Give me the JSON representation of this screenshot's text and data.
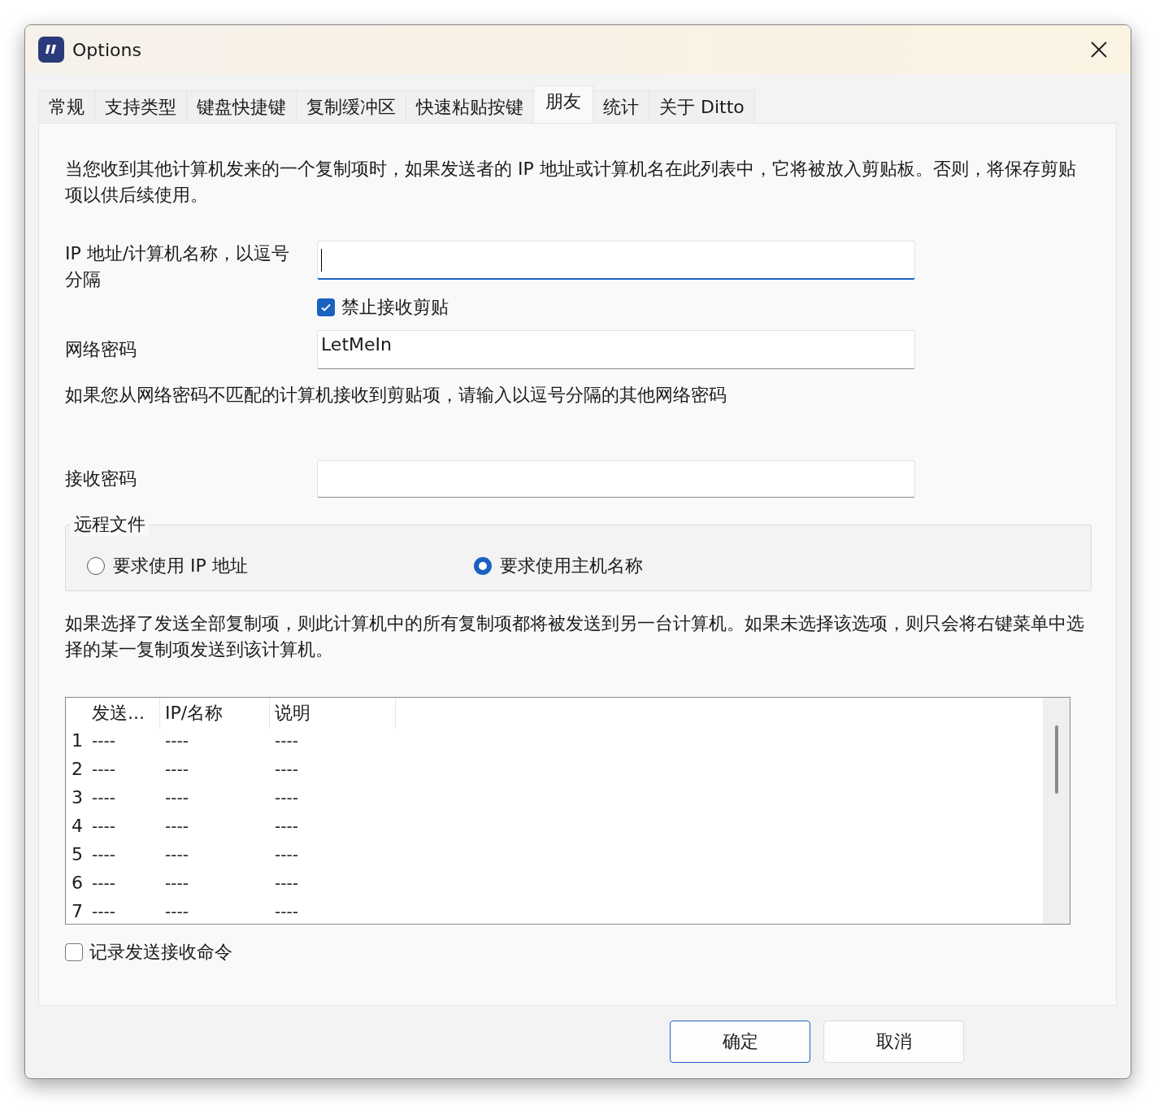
{
  "window": {
    "title": "Options"
  },
  "tabs": [
    {
      "label": "常规",
      "selected": false
    },
    {
      "label": "支持类型",
      "selected": false
    },
    {
      "label": "键盘快捷键",
      "selected": false
    },
    {
      "label": "复制缓冲区",
      "selected": false
    },
    {
      "label": "快速粘贴按键",
      "selected": false
    },
    {
      "label": "朋友",
      "selected": true
    },
    {
      "label": "统计",
      "selected": false
    },
    {
      "label": "关于 Ditto",
      "selected": false
    }
  ],
  "intro": "当您收到其他计算机发来的一个复制项时，如果发送者的 IP 地址或计算机名在此列表中，它将被放入剪贴板。否则，将保存剪贴项以供后续使用。",
  "ip_field": {
    "label": "IP 地址/计算机名称，以逗号分隔",
    "focused": true
  },
  "block_checkbox": {
    "label": "禁止接收剪贴",
    "checked": true
  },
  "network_password": {
    "label": "网络密码",
    "value": "LetMeIn"
  },
  "password_hint": "如果您从网络密码不匹配的计算机接收到剪贴项，请输入以逗号分隔的其他网络密码",
  "receive_password": {
    "label": "接收密码"
  },
  "remote_files": {
    "title": "远程文件",
    "options": [
      {
        "label": "要求使用 IP 地址",
        "selected": false
      },
      {
        "label": "要求使用主机名称",
        "selected": true
      }
    ]
  },
  "send_all_note": "如果选择了发送全部复制项，则此计算机中的所有复制项都将被发送到另一台计算机。如果未选择该选项，则只会将右键菜单中选择的某一复制项发送到该计算机。",
  "table": {
    "columns": [
      "发送...",
      "IP/名称",
      "说明"
    ],
    "rows": [
      {
        "index": "1",
        "cells": [
          "----",
          "----",
          "----"
        ]
      },
      {
        "index": "2",
        "cells": [
          "----",
          "----",
          "----"
        ]
      },
      {
        "index": "3",
        "cells": [
          "----",
          "----",
          "----"
        ]
      },
      {
        "index": "4",
        "cells": [
          "----",
          "----",
          "----"
        ]
      },
      {
        "index": "5",
        "cells": [
          "----",
          "----",
          "----"
        ]
      },
      {
        "index": "6",
        "cells": [
          "----",
          "----",
          "----"
        ]
      },
      {
        "index": "7",
        "cells": [
          "----",
          "----",
          "----"
        ]
      }
    ]
  },
  "log_checkbox": {
    "label": "记录发送接收命令",
    "checked": false
  },
  "buttons": [
    {
      "label": "确定",
      "default": true
    },
    {
      "label": "取消",
      "default": false
    }
  ]
}
